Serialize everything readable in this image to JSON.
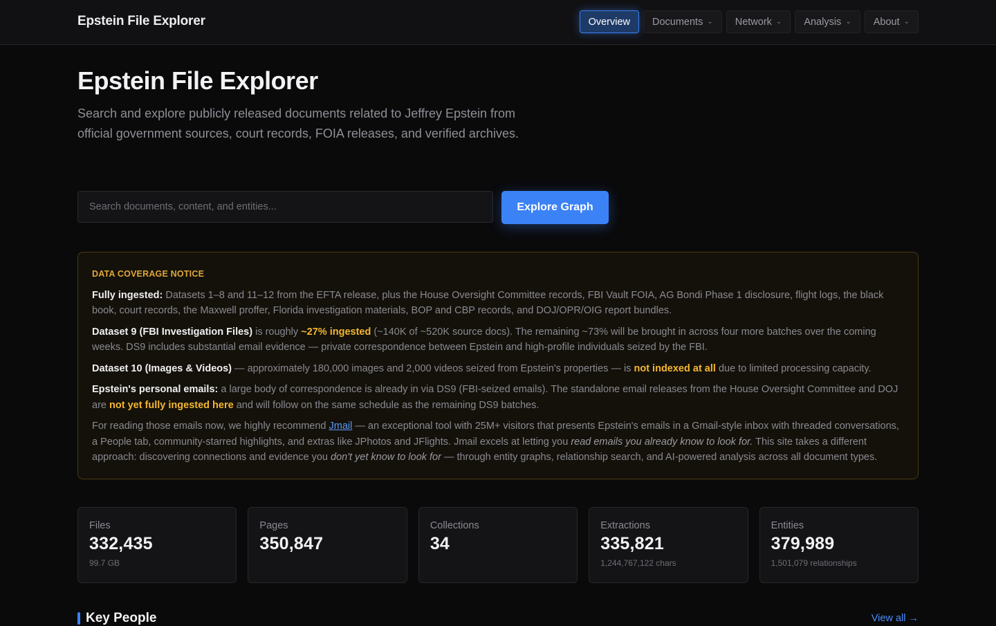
{
  "header": {
    "brand": "Epstein File Explorer",
    "nav": [
      {
        "label": "Overview",
        "active": true,
        "dropdown": false
      },
      {
        "label": "Documents",
        "active": false,
        "dropdown": true
      },
      {
        "label": "Network",
        "active": false,
        "dropdown": true
      },
      {
        "label": "Analysis",
        "active": false,
        "dropdown": true
      },
      {
        "label": "About",
        "active": false,
        "dropdown": true
      }
    ],
    "dropdown_icon": "chevron-down-icon"
  },
  "hero": {
    "title": "Epstein File Explorer",
    "subtitle": "Search and explore publicly released documents related to Jeffrey Epstein from official government sources, court records, FOIA releases, and verified archives.",
    "search_placeholder": "Search documents, content, and entities...",
    "explore_button": "Explore Graph"
  },
  "notice": {
    "title": "DATA COVERAGE NOTICE",
    "p1_label": "Fully ingested:",
    "p1_text": " Datasets 1–8 and 11–12 from the EFTA release, plus the House Oversight Committee records, FBI Vault FOIA, AG Bondi Phase 1 disclosure, flight logs, the black book, court records, the Maxwell proffer, Florida investigation materials, BOP and CBP records, and DOJ/OPR/OIG report bundles.",
    "p2_label": "Dataset 9 (FBI Investigation Files)",
    "p2_text_a": " is roughly ",
    "p2_hl": "~27% ingested",
    "p2_text_b": " (~140K of ~520K source docs). The remaining ~73% will be brought in across four more batches over the coming weeks. DS9 includes substantial email evidence — private correspondence between Epstein and high-profile individuals seized by the FBI.",
    "p3_label": "Dataset 10 (Images & Videos)",
    "p3_text_a": " — approximately 180,000 images and 2,000 videos seized from Epstein's properties — is ",
    "p3_hl": "not indexed at all",
    "p3_text_b": " due to limited processing capacity.",
    "p4_label": "Epstein's personal emails:",
    "p4_text_a": " a large body of correspondence is already in via DS9 (FBI-seized emails). The standalone email releases from the House Oversight Committee and DOJ are ",
    "p4_hl": "not yet fully ingested here",
    "p4_text_b": " and will follow on the same schedule as the remaining DS9 batches.",
    "p5_text_a": "For reading those emails now, we highly recommend ",
    "p5_link": "Jmail",
    "p5_text_b": " — an exceptional tool with 25M+ visitors that presents Epstein's emails in a Gmail-style inbox with threaded conversations, a People tab, community-starred highlights, and extras like JPhotos and JFlights. Jmail excels at letting you ",
    "p5_em1": "read emails you already know to look for.",
    "p5_text_c": " This site takes a different approach: discovering connections and evidence you ",
    "p5_em2": "don't yet know to look for",
    "p5_text_d": " — through entity graphs, relationship search, and AI-powered analysis across all document types."
  },
  "stats": [
    {
      "label": "Files",
      "value": "332,435",
      "sub": "99.7 GB"
    },
    {
      "label": "Pages",
      "value": "350,847",
      "sub": ""
    },
    {
      "label": "Collections",
      "value": "34",
      "sub": ""
    },
    {
      "label": "Extractions",
      "value": "335,821",
      "sub": "1,244,767,122 chars"
    },
    {
      "label": "Entities",
      "value": "379,989",
      "sub": "1,501,079 relationships"
    }
  ],
  "key_people": {
    "title": "Key People",
    "view_all": "View all →"
  },
  "colors": {
    "accent": "#3b82f6",
    "warning": "#f5b731",
    "background": "#0a0a0b"
  }
}
